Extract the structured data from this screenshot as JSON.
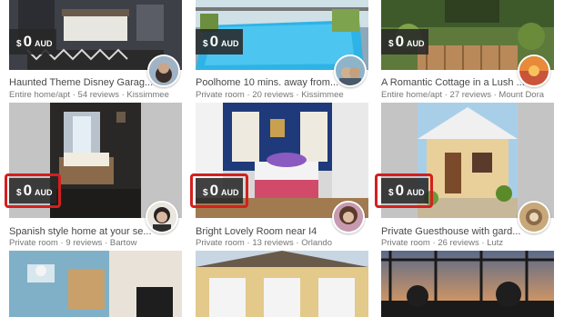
{
  "listings": [
    {
      "title": "Haunted Theme Disney Garag...",
      "type": "Entire home/apt",
      "reviews": "54 reviews",
      "location": "Kissimmee",
      "price": {
        "symbol": "$",
        "amount": "0",
        "currency": "AUD"
      },
      "highlighted": false
    },
    {
      "title": "Poolhome 10 mins. away from...",
      "type": "Private room",
      "reviews": "20 reviews",
      "location": "Kissimmee",
      "price": {
        "symbol": "$",
        "amount": "0",
        "currency": "AUD"
      },
      "highlighted": false
    },
    {
      "title": "A Romantic Cottage in a Lush ...",
      "type": "Entire home/apt",
      "reviews": "27 reviews",
      "location": "Mount Dora",
      "price": {
        "symbol": "$",
        "amount": "0",
        "currency": "AUD"
      },
      "highlighted": false
    },
    {
      "title": "Spanish style home at your se...",
      "type": "Private room",
      "reviews": "9 reviews",
      "location": "Bartow",
      "price": {
        "symbol": "$",
        "amount": "0",
        "currency": "AUD"
      },
      "highlighted": true
    },
    {
      "title": "Bright Lovely Room near I4",
      "type": "Private room",
      "reviews": "13 reviews",
      "location": "Orlando",
      "price": {
        "symbol": "$",
        "amount": "0",
        "currency": "AUD"
      },
      "highlighted": true
    },
    {
      "title": "Private Guesthouse with gard...",
      "type": "Private room",
      "reviews": "26 reviews",
      "location": "Lutz",
      "price": {
        "symbol": "$",
        "amount": "0",
        "currency": "AUD"
      },
      "highlighted": true
    }
  ],
  "separator": "·",
  "highlight_color": "#d41f1f"
}
